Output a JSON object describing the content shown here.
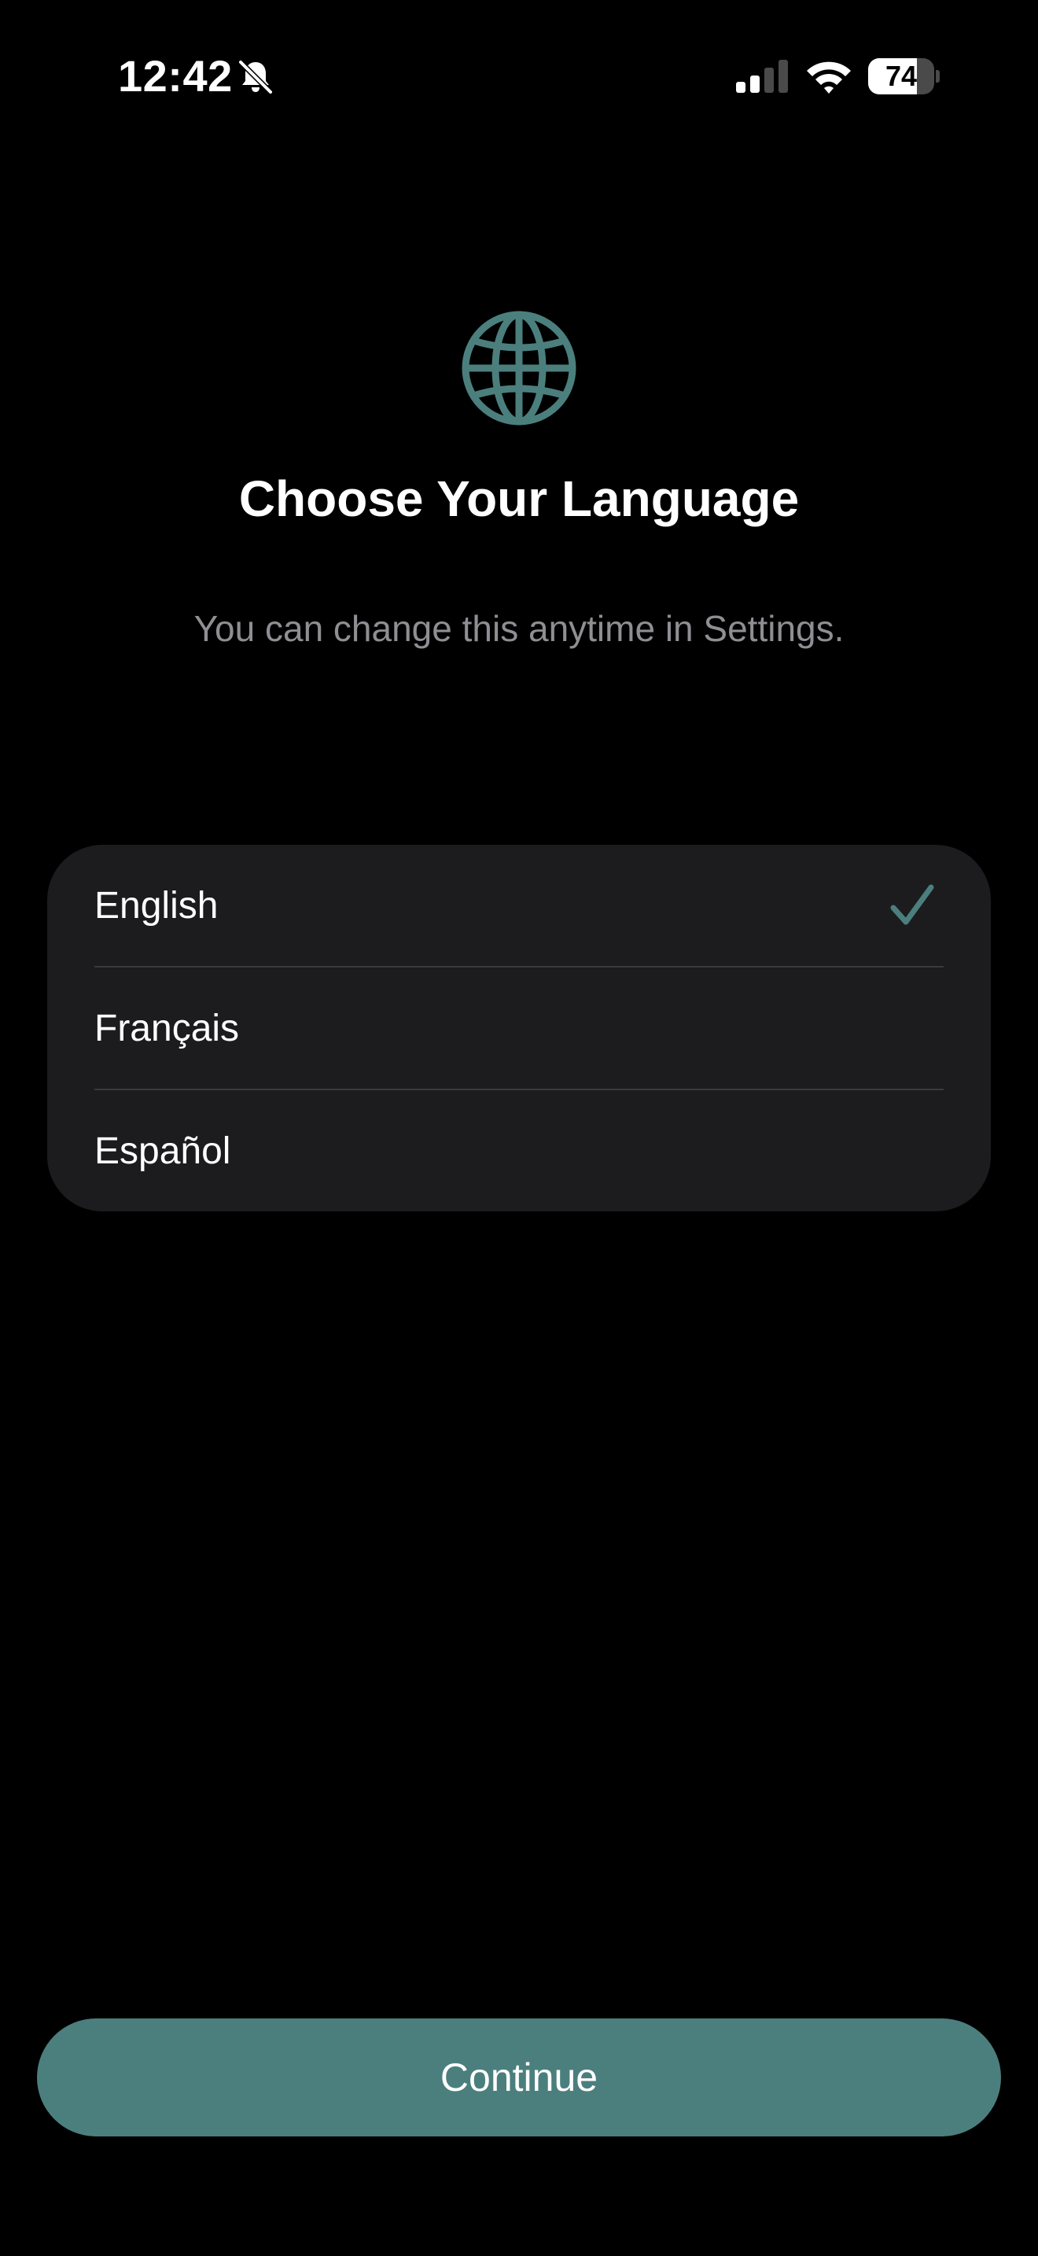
{
  "status_bar": {
    "time": "12:42",
    "battery_percent": "74",
    "battery_level": 0.74,
    "signal_bars_active": 2,
    "icons": [
      "bell-slash-icon",
      "cellular-signal-icon",
      "wifi-icon",
      "battery-icon"
    ]
  },
  "header": {
    "icon": "globe-icon",
    "title": "Choose Your Language",
    "subtitle": "You can change this anytime in Settings."
  },
  "languages": {
    "items": [
      {
        "label": "English",
        "selected": true
      },
      {
        "label": "Français",
        "selected": false
      },
      {
        "label": "Español",
        "selected": false
      }
    ],
    "selected_icon": "checkmark-icon"
  },
  "footer": {
    "continue_label": "Continue"
  },
  "colors": {
    "background": "#000000",
    "card": "#1c1c1e",
    "divider": "#3a3a3c",
    "accent": "#4b7f7d",
    "secondary_text": "#8e8e93",
    "primary_text": "#ffffff"
  }
}
